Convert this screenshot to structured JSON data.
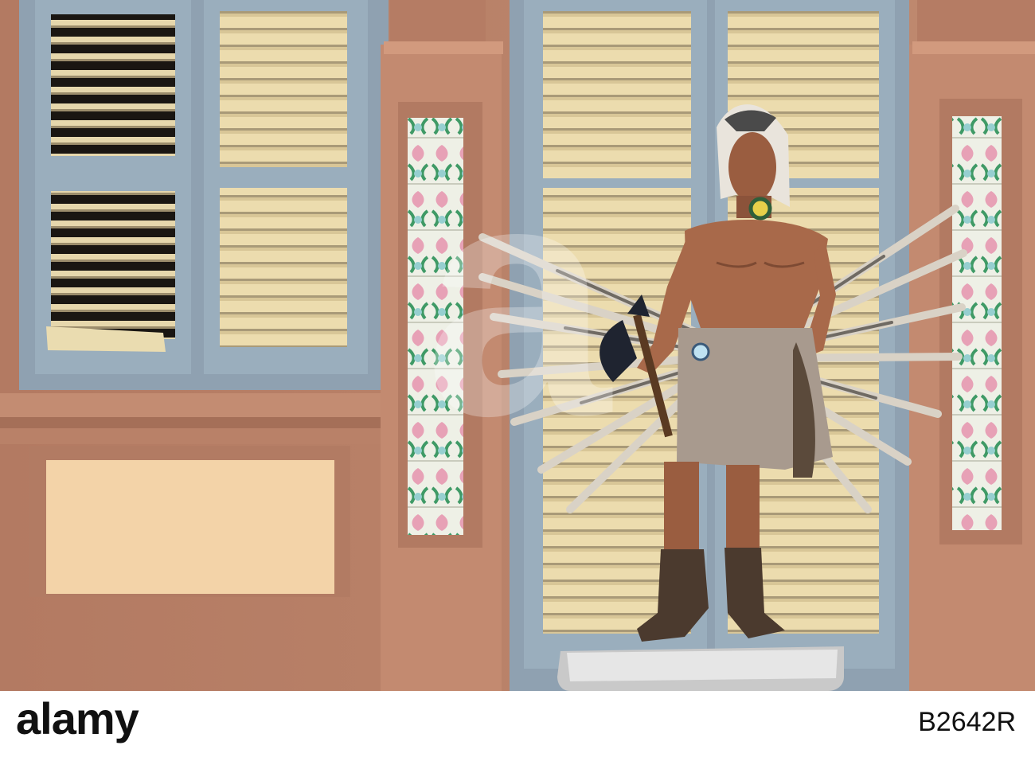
{
  "footer": {
    "brand": "alamy",
    "stock_id": "B2642R"
  },
  "watermark": {
    "text": "a"
  },
  "colors": {
    "wall": "#b97f66",
    "shutter_frame": "#98a9b8",
    "slats": "#ecdcae",
    "panel": "#f3d3a8",
    "skin": "#a8694a",
    "skirt": "#a89a8e",
    "base": "#d9d9d9"
  },
  "icons": {
    "watermark": "alamy-a-watermark-icon",
    "feathers": "feather-wings-icon",
    "axe": "tomahawk-icon"
  }
}
